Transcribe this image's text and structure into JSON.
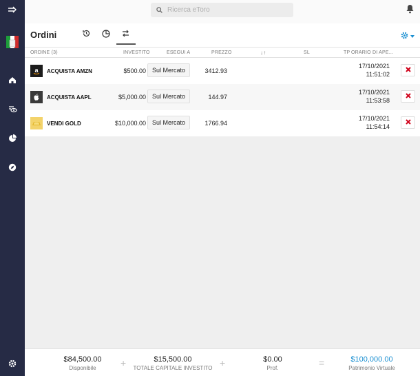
{
  "sidebar": {
    "icons": [
      "expand-arrow-icon",
      "italy-flag-icon",
      "home-icon",
      "watchlist-icon",
      "portfolio-icon",
      "discover-icon",
      "settings-icon"
    ]
  },
  "search": {
    "placeholder": "Ricerca eToro"
  },
  "page": {
    "title": "Ordini",
    "tabs": [
      "history-icon",
      "portfolio-pie-icon",
      "transfer-arrows-icon"
    ]
  },
  "table": {
    "headers": {
      "order": "ORDINE (3)",
      "invested": "INVESTITO",
      "execute_at": "ESEGUI A",
      "price": "PREZZO",
      "sort": "↓↑",
      "sl": "SL",
      "tp": "TP",
      "open_time": "ORARIO DI APE..."
    },
    "rows": [
      {
        "logo": "amazon-logo-icon",
        "name": "ACQUISTA AMZN",
        "invested": "$500.00",
        "execute_at": "Sul Mercato",
        "price": "3412.93",
        "date": "17/10/2021",
        "time": "11:51:02"
      },
      {
        "logo": "apple-logo-icon",
        "name": "ACQUISTA AAPL",
        "invested": "$5,000.00",
        "execute_at": "Sul Mercato",
        "price": "144.97",
        "date": "17/10/2021",
        "time": "11:53:58"
      },
      {
        "logo": "gold-bar-icon",
        "name": "VENDI GOLD",
        "invested": "$10,000.00",
        "execute_at": "Sul Mercato",
        "price": "1766.94",
        "date": "17/10/2021",
        "time": "11:54:14"
      }
    ]
  },
  "footer": {
    "available": {
      "value": "$84,500.00",
      "label": "Disponibile"
    },
    "plus1": "+",
    "invested_total": {
      "value": "$15,500.00",
      "label": "TOTALE CAPITALE INVESTITO"
    },
    "plus2": "+",
    "profit": {
      "value": "$0.00",
      "label": "Prof."
    },
    "equals": "=",
    "equity": {
      "value": "$100,000.00",
      "label": "Patrimonio Virtuale"
    }
  },
  "colors": {
    "sidebar": "#262b45",
    "accent": "#1a8fd1",
    "close_red": "#d0021b"
  }
}
